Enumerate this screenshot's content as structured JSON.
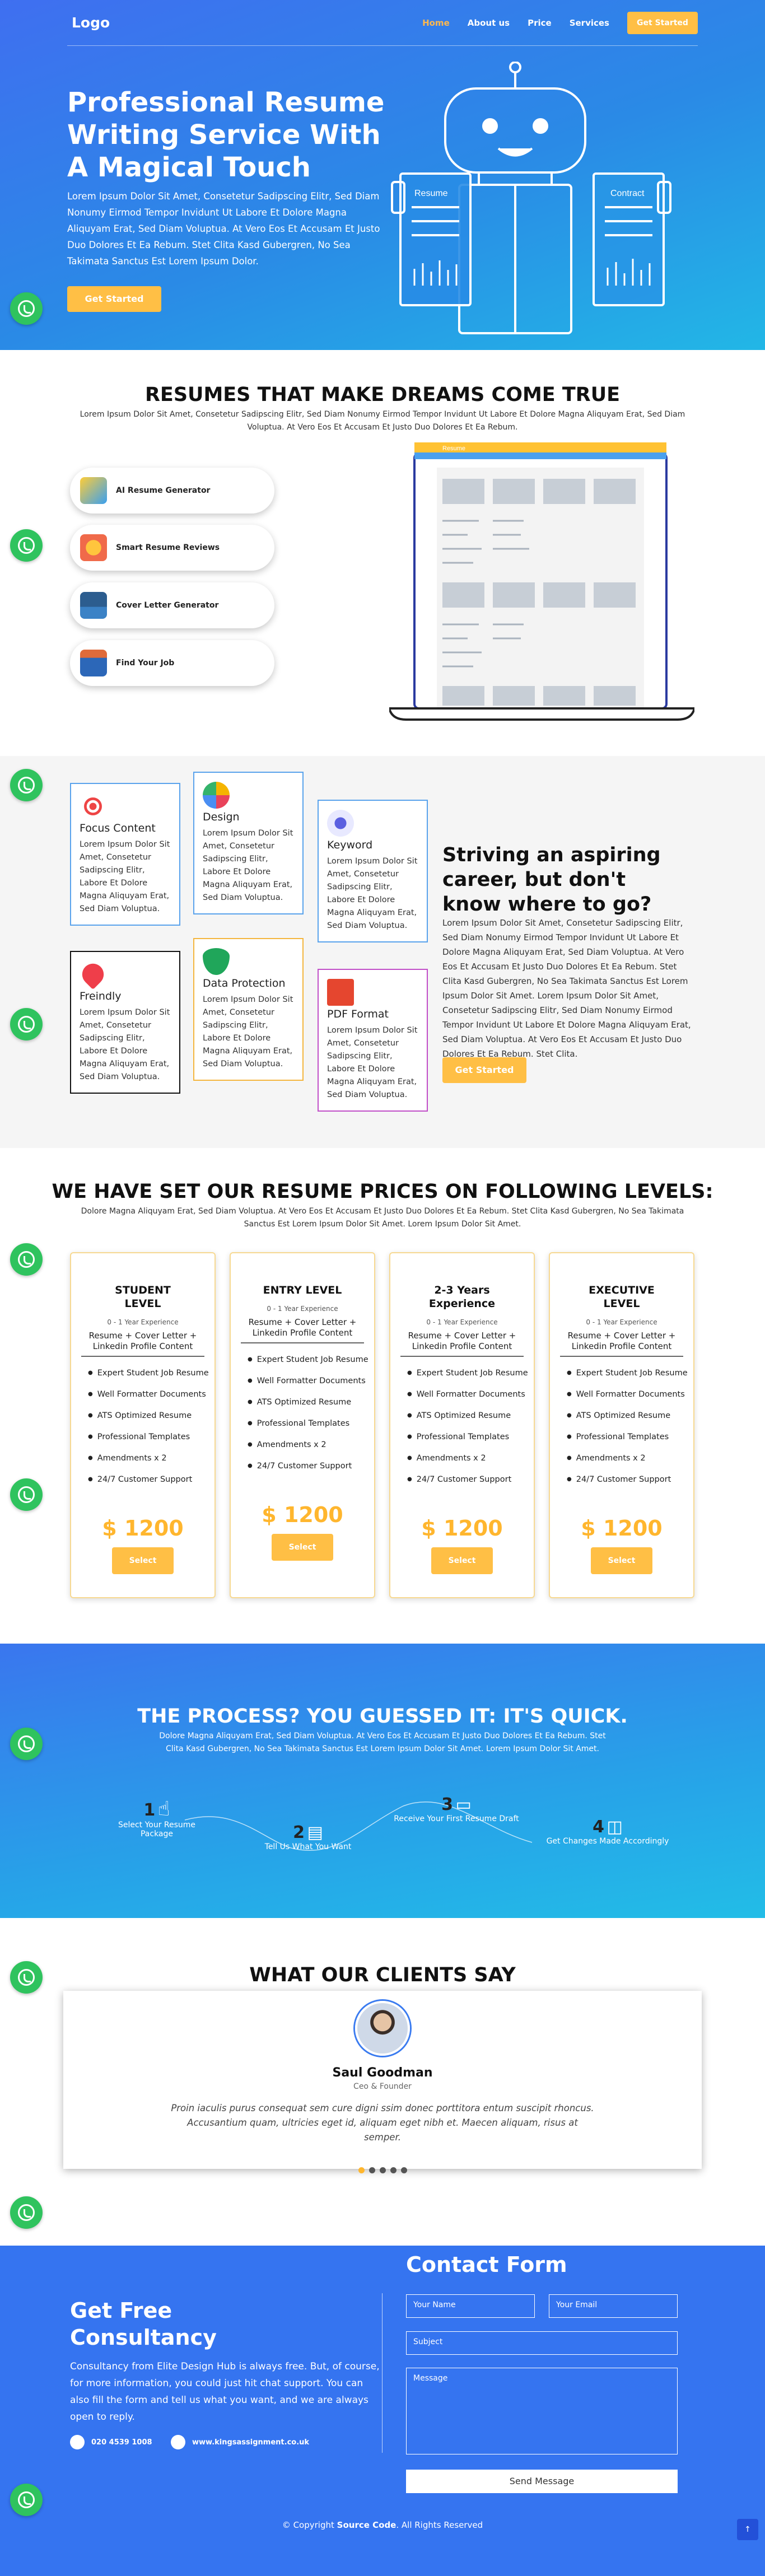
{
  "nav": {
    "logo": "Logo",
    "links": [
      "Home",
      "About us",
      "Price",
      "Services"
    ],
    "cta": "Get Started"
  },
  "hero": {
    "title": "Professional Resume Writing Service With A Magical Touch",
    "text": "Lorem Ipsum Dolor Sit Amet, Consetetur Sadipscing Elitr, Sed Diam Nonumy Eirmod Tempor Invidunt Ut Labore Et Dolore Magna Aliquyam Erat, Sed Diam Voluptua. At Vero Eos Et Accusam Et Justo Duo Dolores Et Ea Rebum. Stet Clita Kasd Gubergren, No Sea Takimata Sanctus Est Lorem Ipsum Dolor.",
    "cta": "Get Started",
    "doc_left": "Resume",
    "doc_right": "Contract"
  },
  "dreams": {
    "title": "RESUMES THAT MAKE DREAMS COME TRUE",
    "text": "Lorem Ipsum Dolor Sit Amet, Consetetur Sadipscing Elitr, Sed Diam Nonumy Eirmod Tempor Invidunt Ut Labore Et Dolore Magna Aliquyam Erat, Sed Diam Voluptua. At Vero Eos Et Accusam Et Justo Duo Dolores Et Ea Rebum.",
    "features": [
      "AI Resume Generator",
      "Smart Resume Reviews",
      "Cover Letter Generator",
      "Find Your Job"
    ],
    "screen_label": "Resume"
  },
  "career": {
    "cards": [
      {
        "title": "Focus Content",
        "text": "Lorem Ipsum Dolor Sit Amet, Consetetur Sadipscing Elitr, Labore Et Dolore Magna Aliquyam Erat, Sed Diam Voluptua."
      },
      {
        "title": "Design",
        "text": "Lorem Ipsum Dolor Sit Amet, Consetetur Sadipscing Elitr, Labore Et Dolore Magna Aliquyam Erat, Sed Diam Voluptua."
      },
      {
        "title": "Keyword",
        "text": "Lorem Ipsum Dolor Sit Amet, Consetetur Sadipscing Elitr, Labore Et Dolore Magna Aliquyam Erat, Sed Diam Voluptua."
      },
      {
        "title": "Freindly",
        "text": "Lorem Ipsum Dolor Sit Amet, Consetetur Sadipscing Elitr, Labore Et Dolore Magna Aliquyam Erat, Sed Diam Voluptua."
      },
      {
        "title": "Data Protection",
        "text": "Lorem Ipsum Dolor Sit Amet, Consetetur Sadipscing Elitr, Labore Et Dolore Magna Aliquyam Erat, Sed Diam Voluptua."
      },
      {
        "title": "PDF Format",
        "text": "Lorem Ipsum Dolor Sit Amet, Consetetur Sadipscing Elitr, Labore Et Dolore Magna Aliquyam Erat, Sed Diam Voluptua."
      }
    ],
    "heading": "Striving an aspiring career, but don't know where to go?",
    "text": "Lorem Ipsum Dolor Sit Amet, Consetetur Sadipscing Elitr, Sed Diam Nonumy Eirmod Tempor Invidunt Ut Labore Et Dolore Magna Aliquyam Erat, Sed Diam Voluptua. At Vero Eos Et Accusam Et Justo Duo Dolores Et Ea Rebum. Stet Clita Kasd Gubergren, No Sea Takimata Sanctus Est Lorem Ipsum Dolor Sit Amet. Lorem Ipsum Dolor Sit Amet, Consetetur Sadipscing Elitr, Sed Diam Nonumy Eirmod Tempor Invidunt Ut Labore Et Dolore Magna Aliquyam Erat, Sed Diam Voluptua. At Vero Eos Et Accusam Et Justo Duo Dolores Et Ea Rebum. Stet Clita.",
    "cta": "Get Started"
  },
  "pricing": {
    "title": "WE HAVE SET OUR RESUME PRICES ON FOLLOWING LEVELS:",
    "text": "Dolore Magna Aliquyam Erat, Sed Diam Voluptua. At Vero Eos Et Accusam Et Justo Duo Dolores Et Ea Rebum. Stet Clita Kasd Gubergren, No Sea Takimata Sanctus Est Lorem Ipsum Dolor Sit Amet. Lorem Ipsum Dolor Sit Amet.",
    "plans": [
      {
        "name": "STUDENT LEVEL",
        "exp": "0 - 1 Year Experience",
        "pkg": "Resume + Cover Letter + Linkedin Profile Content",
        "price": "$ 1200",
        "btn": "Select"
      },
      {
        "name": "ENTRY LEVEL",
        "exp": "0 - 1 Year Experience",
        "pkg": "Resume + Cover Letter + Linkedin Profile Content",
        "price": "$ 1200",
        "btn": "Select"
      },
      {
        "name": "2-3 Years Experience",
        "exp": "0 - 1 Year Experience",
        "pkg": "Resume + Cover Letter + Linkedin Profile Content",
        "price": "$ 1200",
        "btn": "Select"
      },
      {
        "name": "EXECUTIVE LEVEL",
        "exp": "0 - 1 Year Experience",
        "pkg": "Resume + Cover Letter + Linkedin Profile Content",
        "price": "$ 1200",
        "btn": "Select"
      }
    ],
    "features": [
      "Expert Student Job Resume",
      "Well Formatter Documents",
      "ATS Optimized Resume",
      "Professional Templates",
      "Amendments x 2",
      "24/7 Customer Support"
    ]
  },
  "process": {
    "title": "THE PROCESS? YOU GUESSED IT: IT'S QUICK.",
    "text": "Dolore Magna Aliquyam Erat, Sed Diam Voluptua. At Vero Eos Et Accusam Et Justo Duo Dolores Et Ea Rebum. Stet Clita Kasd Gubergren, No Sea Takimata Sanctus Est Lorem Ipsum Dolor Sit Amet. Lorem Ipsum Dolor Sit Amet.",
    "steps": [
      {
        "num": "1",
        "label": "Select Your Resume Package"
      },
      {
        "num": "2",
        "label": "Tell Us What You Want"
      },
      {
        "num": "3",
        "label": "Receive Your First Resume Draft"
      },
      {
        "num": "4",
        "label": "Get Changes Made Accordingly"
      }
    ]
  },
  "clients": {
    "title": "WHAT OUR CLIENTS SAY",
    "name": "Saul Goodman",
    "role": "Ceo & Founder",
    "quote": "Proin iaculis purus consequat sem cure digni ssim donec porttitora entum suscipit rhoncus. Accusantium quam, ultricies eget id, aliquam eget nibh et. Maecen aliquam, risus at semper.",
    "active_dot": 0,
    "dot_count": 5
  },
  "contact": {
    "left_title": "Get Free Consultancy",
    "left_text": "Consultancy from Elite Design Hub is always free. But, of course, for more information, you could just hit chat support. You can also fill the form and tell us what you want, and we are always open to reply.",
    "phone": "020 4539 1008",
    "web": "www.kingsassignment.co.uk",
    "form_title": "Contact Form",
    "name_ph": "Your Name",
    "email_ph": "Your Email",
    "subject_ph": "Subject",
    "message_ph": "Message",
    "send": "Send Message",
    "copyright_pre": "© Copyright ",
    "copyright_brand": "Source Code",
    "copyright_post": ". All Rights Reserved",
    "totop": "↑"
  },
  "colors": {
    "accent": "#ffbf45",
    "primary": "#3574f0",
    "whatsapp": "#2fc35e"
  }
}
